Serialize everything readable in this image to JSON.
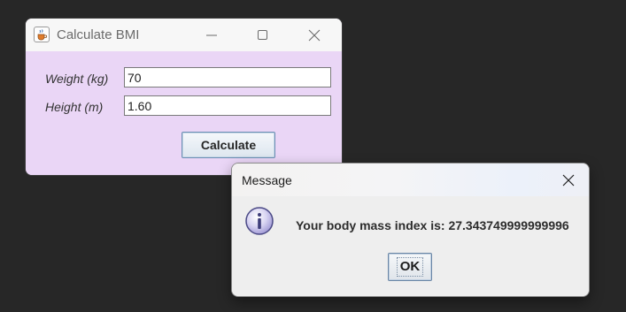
{
  "main_window": {
    "title": "Calculate BMI",
    "icon": "java-cup-icon",
    "controls": [
      "minimize-icon",
      "maximize-icon",
      "close-icon"
    ],
    "background_color": "#ead6f6",
    "fields": {
      "weight_label": "Weight (kg)",
      "weight_value": "70",
      "height_label": "Height (m)",
      "height_value": "1.60"
    },
    "calculate_label": "Calculate"
  },
  "message_dialog": {
    "title": "Message",
    "icon": "info-icon",
    "text": "Your body mass index is: 27.343749999999996",
    "ok_label": "OK"
  }
}
